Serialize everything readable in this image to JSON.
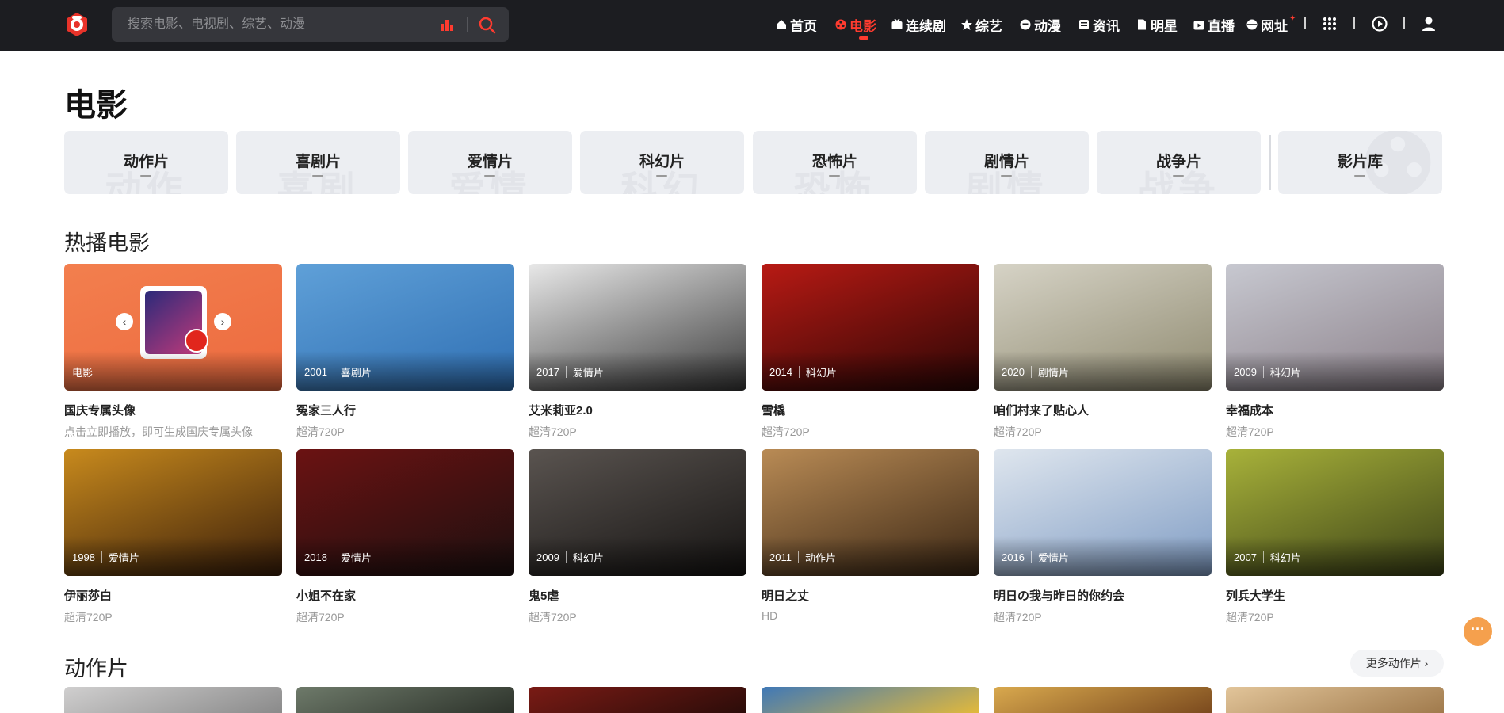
{
  "search": {
    "placeholder": "搜索电影、电视剧、综艺、动漫"
  },
  "nav": {
    "items": [
      {
        "label": "首页",
        "icon": "home-icon"
      },
      {
        "label": "电影",
        "icon": "film-reel-icon",
        "active": true
      },
      {
        "label": "连续剧",
        "icon": "tv-icon"
      },
      {
        "label": "综艺",
        "icon": "star-icon"
      },
      {
        "label": "动漫",
        "icon": "anime-face-icon"
      },
      {
        "label": "资讯",
        "icon": "news-icon"
      },
      {
        "label": "明星",
        "icon": "document-icon"
      },
      {
        "label": "直播",
        "icon": "live-tv-icon"
      },
      {
        "label": "网址",
        "icon": "globe-icon"
      }
    ],
    "accent": "#ff3b2f"
  },
  "page_title": "电影",
  "genres": [
    {
      "label": "动作片",
      "bg": "动作"
    },
    {
      "label": "喜剧片",
      "bg": "喜剧"
    },
    {
      "label": "爱情片",
      "bg": "爱情"
    },
    {
      "label": "科幻片",
      "bg": "科幻"
    },
    {
      "label": "恐怖片",
      "bg": "恐怖"
    },
    {
      "label": "剧情片",
      "bg": "剧情"
    },
    {
      "label": "战争片",
      "bg": "战争"
    },
    {
      "label": "影片库",
      "bg": ""
    }
  ],
  "hot_section": {
    "title": "热播电影",
    "cards": [
      {
        "title": "国庆专属头像",
        "sub": "点击立即播放，即可生成国庆专属头像",
        "year": "",
        "genre": "电影",
        "colors": [
          "#f37f4e",
          "#ec6a3f"
        ]
      },
      {
        "title": "冤家三人行",
        "sub": "超清720P",
        "year": "2001",
        "genre": "喜剧片",
        "colors": [
          "#5fa0d8",
          "#2f6fb3"
        ]
      },
      {
        "title": "艾米莉亚2.0",
        "sub": "超清720P",
        "year": "2017",
        "genre": "爱情片",
        "colors": [
          "#e8e8e8",
          "#3a3a3a"
        ]
      },
      {
        "title": "雪橇",
        "sub": "超清720P",
        "year": "2014",
        "genre": "科幻片",
        "colors": [
          "#b81a14",
          "#2a0605"
        ]
      },
      {
        "title": "咱们村来了贴心人",
        "sub": "超清720P",
        "year": "2020",
        "genre": "剧情片",
        "colors": [
          "#d6d3c6",
          "#8f8a70"
        ]
      },
      {
        "title": "幸福成本",
        "sub": "超清720P",
        "year": "2009",
        "genre": "科幻片",
        "colors": [
          "#c7c8d0",
          "#8a7f88"
        ]
      },
      {
        "title": "伊丽莎白",
        "sub": "超清720P",
        "year": "1998",
        "genre": "爱情片",
        "colors": [
          "#c88a1d",
          "#3a1e0a"
        ]
      },
      {
        "title": "小姐不在家",
        "sub": "超清720P",
        "year": "2018",
        "genre": "爱情片",
        "colors": [
          "#6b1212",
          "#1c1010"
        ]
      },
      {
        "title": "鬼5虐",
        "sub": "超清720P",
        "year": "2009",
        "genre": "科幻片",
        "colors": [
          "#5a5450",
          "#151312"
        ]
      },
      {
        "title": "明日之丈",
        "sub": "HD",
        "year": "2011",
        "genre": "动作片",
        "colors": [
          "#b98b55",
          "#3a2614"
        ]
      },
      {
        "title": "明日の我与昨日的你约会",
        "sub": "超清720P",
        "year": "2016",
        "genre": "爱情片",
        "colors": [
          "#dfe6ee",
          "#7f9cc4"
        ]
      },
      {
        "title": "列兵大学生",
        "sub": "超清720P",
        "year": "2007",
        "genre": "科幻片",
        "colors": [
          "#a8b23a",
          "#3c4217"
        ]
      }
    ]
  },
  "action_section": {
    "title": "动作片",
    "more_label": "更多动作片 ›",
    "poster_colors": [
      [
        "#d0cfcf",
        "#8a8a8a"
      ],
      [
        "#6e7a6a",
        "#2c322a"
      ],
      [
        "#7a1b15",
        "#2b0c09"
      ],
      [
        "#3f78b7",
        "#e2b93b"
      ],
      [
        "#d9a94e",
        "#7b4a1e"
      ],
      [
        "#e2c59a",
        "#a07a4c"
      ]
    ]
  },
  "float_button": "···"
}
